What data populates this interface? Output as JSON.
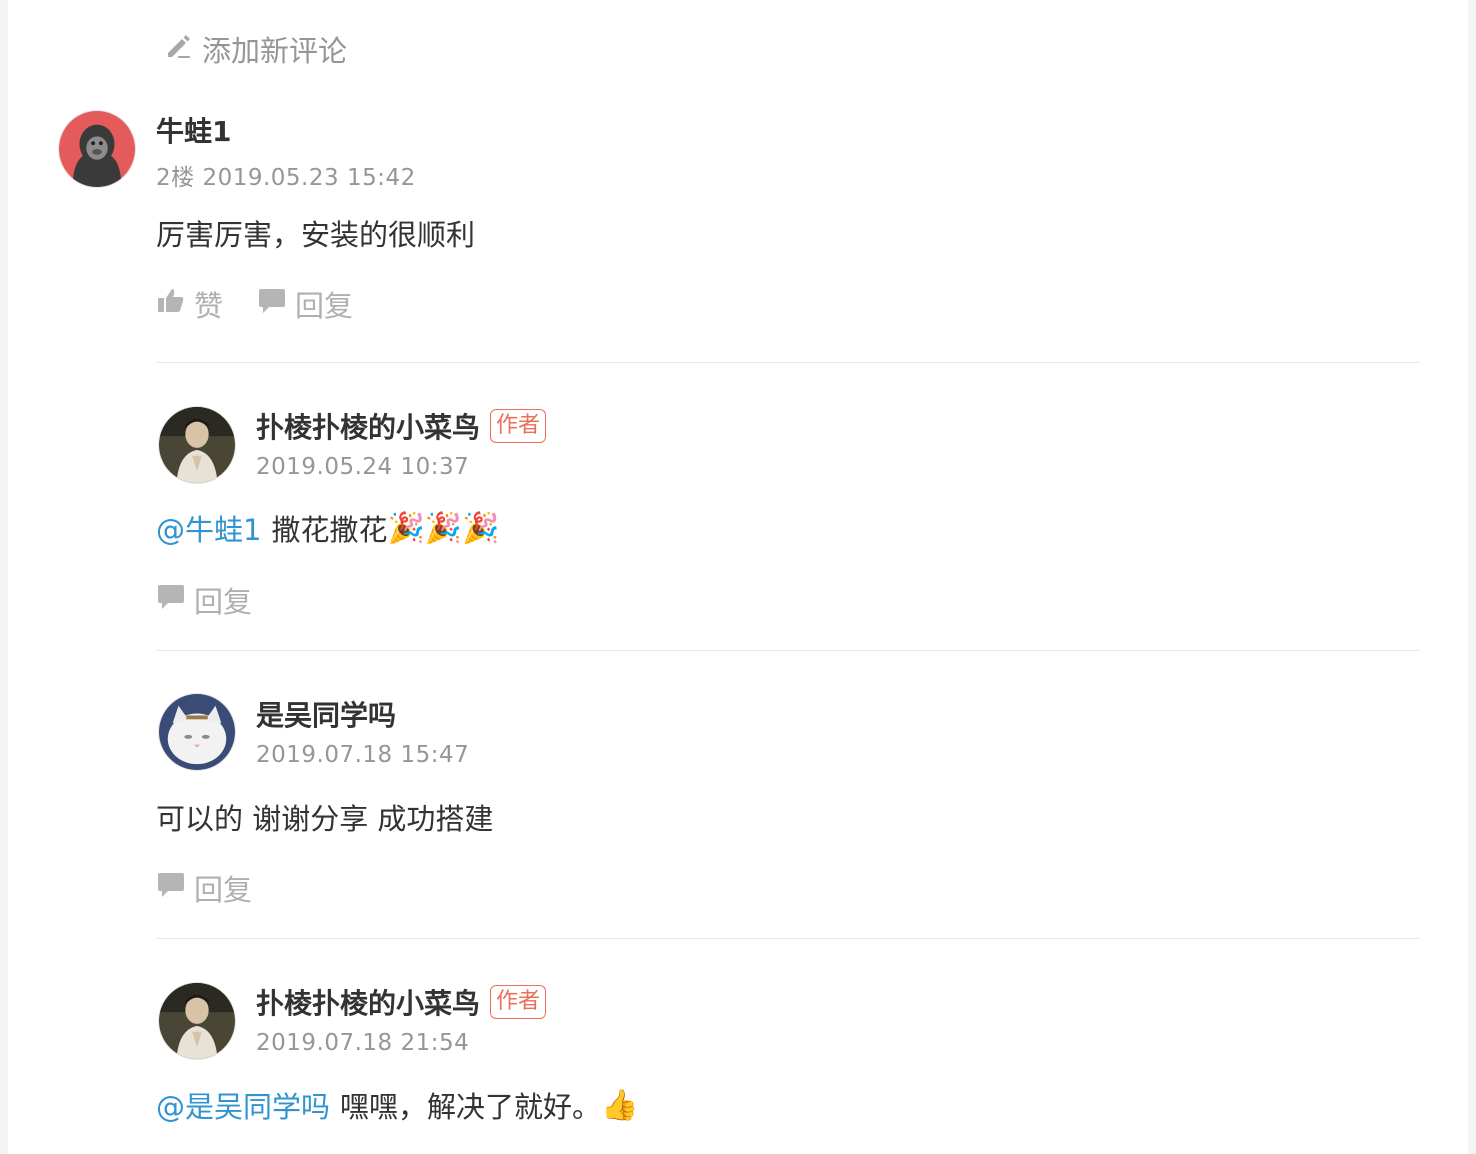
{
  "add_comment": {
    "label": "添加新评论",
    "icon": "pencil-icon"
  },
  "floor_comment": {
    "author": "牛蛙1",
    "meta": "2楼 2019.05.23 15:42",
    "content": "厉害厉害，安装的很顺利",
    "avatar": "gorilla-avatar",
    "like_label": "赞",
    "reply_label": "回复"
  },
  "replies": [
    {
      "author": "扑棱扑棱的小菜鸟",
      "badge": "作者",
      "time": "2019.05.24 10:37",
      "mention": "@牛蛙1",
      "text": "撒花撒花",
      "emoji": "🎉🎉🎉",
      "reply_label": "回复",
      "avatar": "man-portrait-avatar"
    },
    {
      "author": "是吴同学吗",
      "time": "2019.07.18 15:47",
      "text": "可以的 谢谢分享 成功搭建",
      "reply_label": "回复",
      "avatar": "white-cat-avatar"
    },
    {
      "author": "扑棱扑棱的小菜鸟",
      "badge": "作者",
      "time": "2019.07.18 21:54",
      "mention": "@是吴同学吗",
      "text": "嘿嘿，解决了就好。",
      "emoji": "👍",
      "avatar": "man-portrait-avatar"
    }
  ],
  "colors": {
    "accent_link": "#3194d0",
    "author_badge": "#ea6f5a",
    "muted": "#969696"
  }
}
